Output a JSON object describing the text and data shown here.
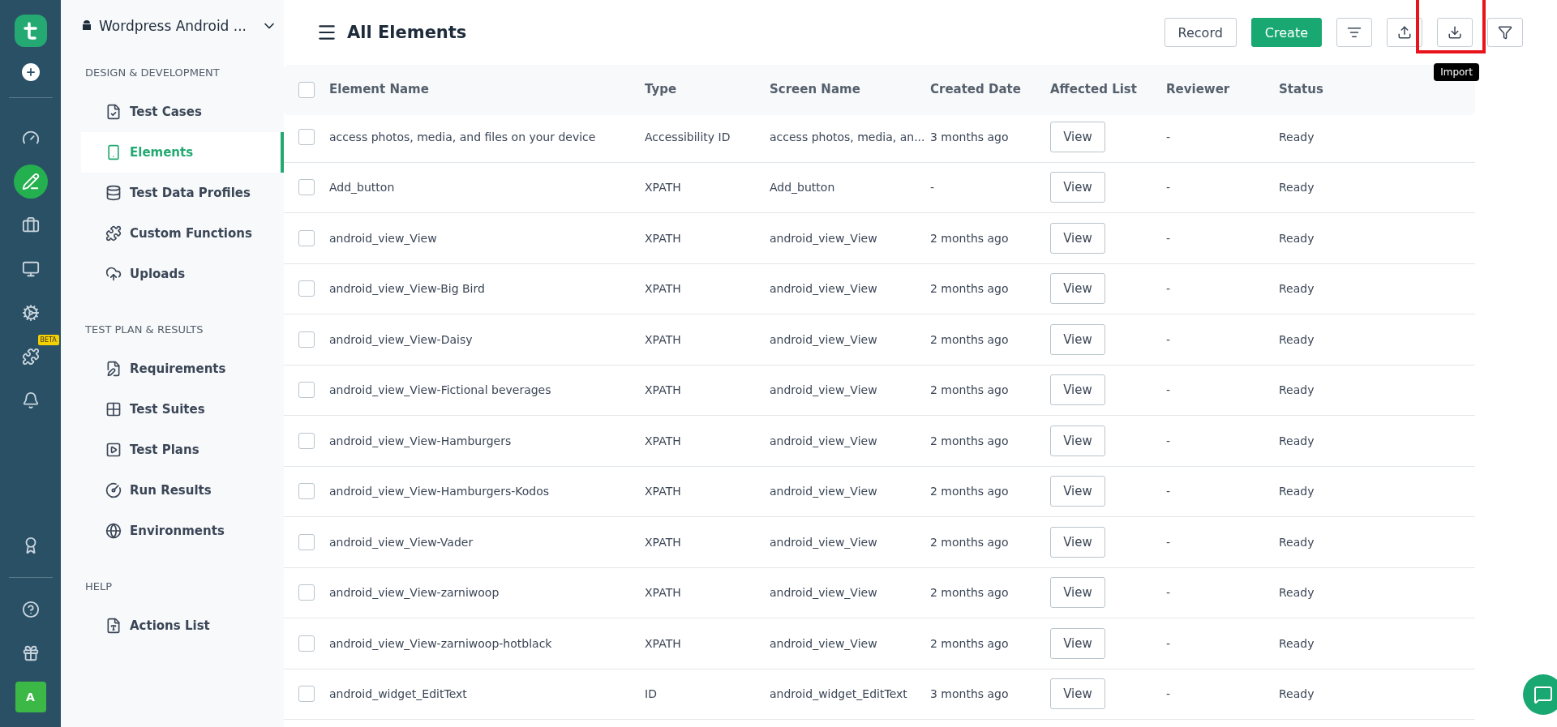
{
  "rail": {
    "items": [
      {
        "kind": "gauge",
        "selected": false
      },
      {
        "kind": "pencil",
        "selected": true
      },
      {
        "kind": "briefcase",
        "selected": false
      },
      {
        "kind": "monitor",
        "selected": false
      },
      {
        "kind": "gear",
        "selected": false
      },
      {
        "kind": "puzzle",
        "selected": false,
        "badge": "BETA"
      },
      {
        "kind": "bell",
        "selected": false
      }
    ],
    "bottom": [
      {
        "kind": "award"
      },
      {
        "kind": "divider"
      },
      {
        "kind": "help"
      },
      {
        "kind": "gift"
      }
    ],
    "avatar": "A"
  },
  "project": "Wordpress Android ...",
  "sidebar": {
    "sections": [
      {
        "title": "DESIGN & DEVELOPMENT",
        "items": [
          {
            "label": "Test Cases",
            "selected": false
          },
          {
            "label": "Elements",
            "selected": true
          },
          {
            "label": "Test Data Profiles",
            "selected": false
          },
          {
            "label": "Custom Functions",
            "selected": false
          },
          {
            "label": "Uploads",
            "selected": false
          }
        ]
      },
      {
        "title": "TEST PLAN & RESULTS",
        "items": [
          {
            "label": "Requirements",
            "selected": false
          },
          {
            "label": "Test Suites",
            "selected": false
          },
          {
            "label": "Test Plans",
            "selected": false
          },
          {
            "label": "Run Results",
            "selected": false
          },
          {
            "label": "Environments",
            "selected": false
          }
        ]
      },
      {
        "title": "HELP",
        "items": [
          {
            "label": "Actions List",
            "selected": false
          }
        ]
      }
    ]
  },
  "page_title": "All Elements",
  "toolbar": {
    "record": "Record",
    "create": "Create",
    "tooltip": "Import"
  },
  "table": {
    "select_all_checked": false,
    "columns": [
      "Element Name",
      "Type",
      "Screen Name",
      "Created Date",
      "Affected List",
      "Reviewer",
      "Status"
    ],
    "rows": [
      {
        "checked": false,
        "cells": [
          "access photos, media, and files on your device",
          "Accessibility ID",
          "access photos, media, an...",
          "3 months ago",
          "View",
          "-",
          "Ready"
        ]
      },
      {
        "checked": false,
        "cells": [
          "Add_button",
          "XPATH",
          "Add_button",
          "-",
          "View",
          "-",
          "Ready"
        ]
      },
      {
        "checked": false,
        "cells": [
          "android_view_View",
          "XPATH",
          "android_view_View",
          "2 months ago",
          "View",
          "-",
          "Ready"
        ]
      },
      {
        "checked": false,
        "cells": [
          "android_view_View-Big Bird",
          "XPATH",
          "android_view_View",
          "2 months ago",
          "View",
          "-",
          "Ready"
        ]
      },
      {
        "checked": false,
        "cells": [
          "android_view_View-Daisy",
          "XPATH",
          "android_view_View",
          "2 months ago",
          "View",
          "-",
          "Ready"
        ]
      },
      {
        "checked": false,
        "cells": [
          "android_view_View-Fictional beverages",
          "XPATH",
          "android_view_View",
          "2 months ago",
          "View",
          "-",
          "Ready"
        ]
      },
      {
        "checked": false,
        "cells": [
          "android_view_View-Hamburgers",
          "XPATH",
          "android_view_View",
          "2 months ago",
          "View",
          "-",
          "Ready"
        ]
      },
      {
        "checked": false,
        "cells": [
          "android_view_View-Hamburgers-Kodos",
          "XPATH",
          "android_view_View",
          "2 months ago",
          "View",
          "-",
          "Ready"
        ]
      },
      {
        "checked": false,
        "cells": [
          "android_view_View-Vader",
          "XPATH",
          "android_view_View",
          "2 months ago",
          "View",
          "-",
          "Ready"
        ]
      },
      {
        "checked": false,
        "cells": [
          "android_view_View-zarniwoop",
          "XPATH",
          "android_view_View",
          "2 months ago",
          "View",
          "-",
          "Ready"
        ]
      },
      {
        "checked": false,
        "cells": [
          "android_view_View-zarniwoop-hotblack",
          "XPATH",
          "android_view_View",
          "2 months ago",
          "View",
          "-",
          "Ready"
        ]
      },
      {
        "checked": false,
        "cells": [
          "android_widget_EditText",
          "ID",
          "android_widget_EditText",
          "3 months ago",
          "View",
          "-",
          "Ready"
        ]
      }
    ]
  }
}
